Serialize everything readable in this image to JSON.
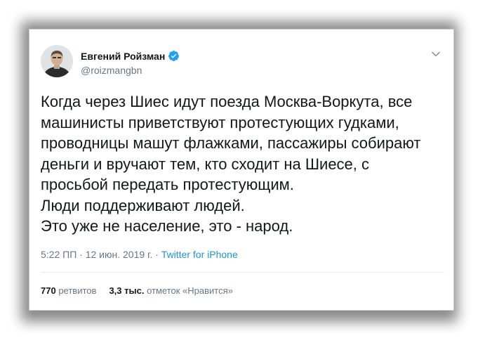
{
  "user": {
    "display_name": "Евгений Ройзман",
    "handle": "@roizmangbn",
    "verified": true,
    "avatar_icon": "person-avatar-icon"
  },
  "tweet": {
    "lines": [
      "Когда через Шиес идут поезда Москва-Воркута, все",
      "машинисты приветствуют протестующих гудками,",
      "проводницы машут флажками, пассажиры собирают",
      "деньги и вручают тем, кто сходит на Шиесе, с",
      "просьбой передать протестующим.",
      "Люди поддерживают людей.",
      "Это уже не население, это - народ."
    ]
  },
  "meta": {
    "time": "5:22 ПП",
    "separator": " · ",
    "date": "12 июн. 2019 г.",
    "via": "Twitter for iPhone"
  },
  "stats": {
    "retweets_count": "770",
    "retweets_label": "ретвитов",
    "likes_count": "3,3 тыс.",
    "likes_label": "отметок «Нравится»"
  },
  "colors": {
    "text": "#14171a",
    "muted": "#657786",
    "link": "#1b95e0",
    "verified": "#1da1f2"
  }
}
